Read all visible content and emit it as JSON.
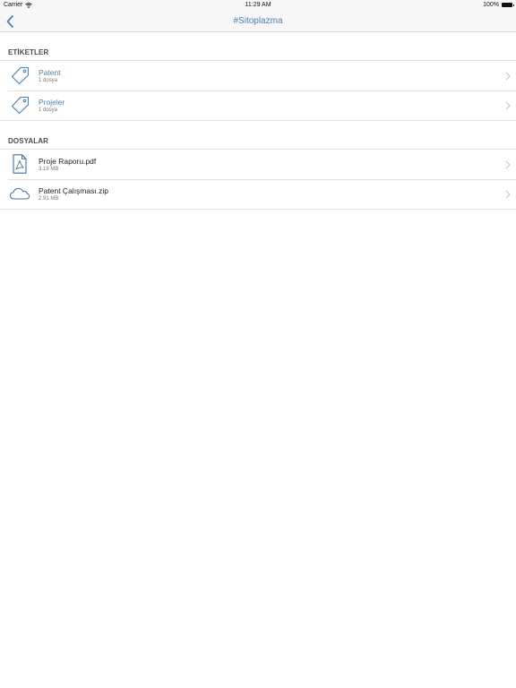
{
  "status_bar": {
    "carrier": "Carrier",
    "time": "11:29 AM",
    "battery_text": "100%",
    "battery_level": 1.0
  },
  "nav": {
    "back_icon": "chevron-left-icon",
    "title": "#Sitoplazma"
  },
  "tags_section": {
    "header": "ETİKETLER",
    "items": [
      {
        "title": "Patent",
        "subtitle": "1 dosya",
        "icon": "tag-icon"
      },
      {
        "title": "Projeler",
        "subtitle": "1 dosya",
        "icon": "tag-icon"
      }
    ]
  },
  "files_section": {
    "header": "DOSYALAR",
    "items": [
      {
        "title": "Proje Raporu.pdf",
        "subtitle": "3.19 MB",
        "icon": "pdf-file-icon"
      },
      {
        "title": "Patent Çalışması.zip",
        "subtitle": "2.91 MB",
        "icon": "cloud-icon"
      }
    ]
  },
  "colors": {
    "accent": "#4a7fb8",
    "bar_background": "#f7f7f7",
    "separator": "#e2e2e2"
  }
}
